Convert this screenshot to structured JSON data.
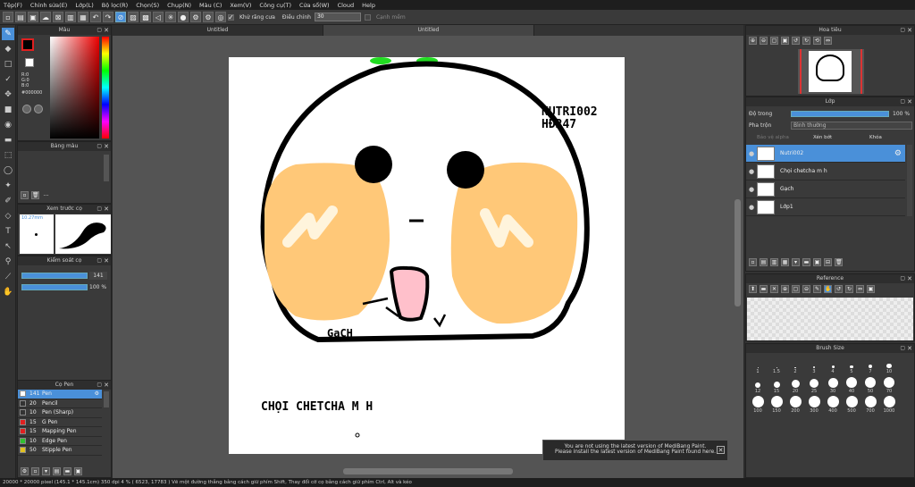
{
  "menu": [
    "Tệp(F)",
    "Chỉnh sửa(E)",
    "Lớp(L)",
    "Bộ lọc(R)",
    "Chọn(S)",
    "Chụp(N)",
    "Màu (C)",
    "Xem(V)",
    "Công cụ(T)",
    "Cửa sổ(W)",
    "Cloud",
    "Help"
  ],
  "toolbar": {
    "antialias": "Khử răng cưa",
    "adjust": "Điều chỉnh",
    "adjust_value": "30",
    "snap": "Cạnh mềm"
  },
  "tabs": [
    "Untitled",
    "Untitled"
  ],
  "panels": {
    "color": "Màu",
    "swatch": "Bảng màu",
    "preview": "Xem trước cọ",
    "control": "Kiểm soát cọ",
    "pens": "Cọ Pen",
    "nav": "Hoa tiêu",
    "layer": "Lớp",
    "reference": "Reference",
    "brushsize": "Brush Size"
  },
  "colorvals": {
    "r": "R:0",
    "g": "G:0",
    "b": "B:0",
    "hex": "#000000"
  },
  "preview": {
    "size": "10.27mm"
  },
  "control": {
    "size": "141",
    "opacity": "100 %"
  },
  "pens": [
    {
      "size": "141",
      "name": "Pen",
      "color": "#ffffff"
    },
    {
      "size": "20",
      "name": "Pencil",
      "color": "#333333"
    },
    {
      "size": "10",
      "name": "Pen (Sharp)",
      "color": "#333333"
    },
    {
      "size": "15",
      "name": "G Pen",
      "color": "#e02020"
    },
    {
      "size": "15",
      "name": "Mapping Pen",
      "color": "#e02020"
    },
    {
      "size": "10",
      "name": "Edge Pen",
      "color": "#30c030"
    },
    {
      "size": "50",
      "name": "Stipple Pen",
      "color": "#e0c020"
    }
  ],
  "layerpanel": {
    "opacity_label": "Độ trong",
    "opacity": "100 %",
    "blend_label": "Pha trộn",
    "blend": "Bình thường",
    "protect": "Bảo vệ alpha",
    "clip": "Xén bớt",
    "lock": "Khóa"
  },
  "layers": [
    {
      "name": "Nutri002",
      "sel": true
    },
    {
      "name": "Chọi chetcha m h",
      "sel": false
    },
    {
      "name": "Gạch",
      "sel": false
    },
    {
      "name": "Lớp1",
      "sel": false
    }
  ],
  "brushsizes": {
    "row1": [
      "1",
      "1.5",
      "2",
      "3",
      "4",
      "5",
      "7",
      "10"
    ],
    "row2": [
      "12",
      "15",
      "20",
      "25",
      "30",
      "40",
      "50",
      "70"
    ],
    "row3": [
      "100",
      "150",
      "200",
      "300",
      "400",
      "500",
      "700",
      "1000"
    ]
  },
  "art": {
    "sig1": "NUTRI002",
    "sig2": "HĐ247",
    "gach": "GạCH",
    "bottom": "CHỌI CHETCHA M H"
  },
  "notice": {
    "line1": "You are not using the latest version of MediBang Paint.",
    "line2": "Please install the latest version of MediBang Paint found here."
  },
  "status": "20000 * 20000 pixel  (145.1 * 145.1cm)  350 dpi  4 %  ( 6523, 17783 )  Vẽ một đường thẳng bằng cách giữ phím Shift, Thay đổi cỡ cọ bằng cách giữ phím Ctrl, Alt và kéo"
}
